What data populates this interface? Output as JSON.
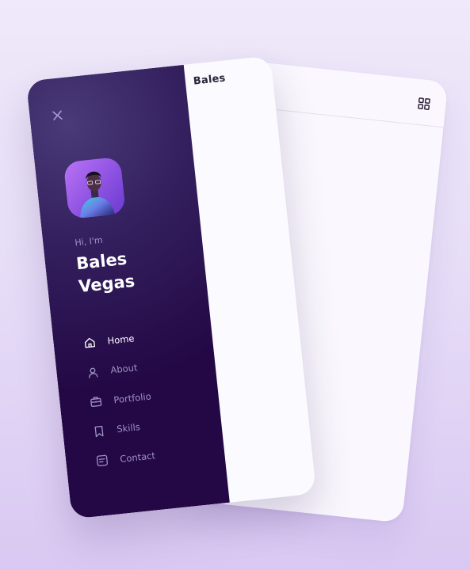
{
  "brand": "Bales",
  "profile": {
    "greeting": "Hi, I'm",
    "first_name": "Bales",
    "last_name": "Vegas"
  },
  "nav": [
    {
      "label": "Home",
      "icon": "home-icon",
      "active": true
    },
    {
      "label": "About",
      "icon": "user-icon",
      "active": false
    },
    {
      "label": "Portfolio",
      "icon": "briefcase-icon",
      "active": false
    },
    {
      "label": "Skills",
      "icon": "bookmark-icon",
      "active": false
    },
    {
      "label": "Contact",
      "icon": "message-icon",
      "active": false
    }
  ],
  "colors": {
    "sidebar": "#230845",
    "accent": "#9d5cf0",
    "background": "#e9e0f8",
    "card": "#fbfaff"
  }
}
